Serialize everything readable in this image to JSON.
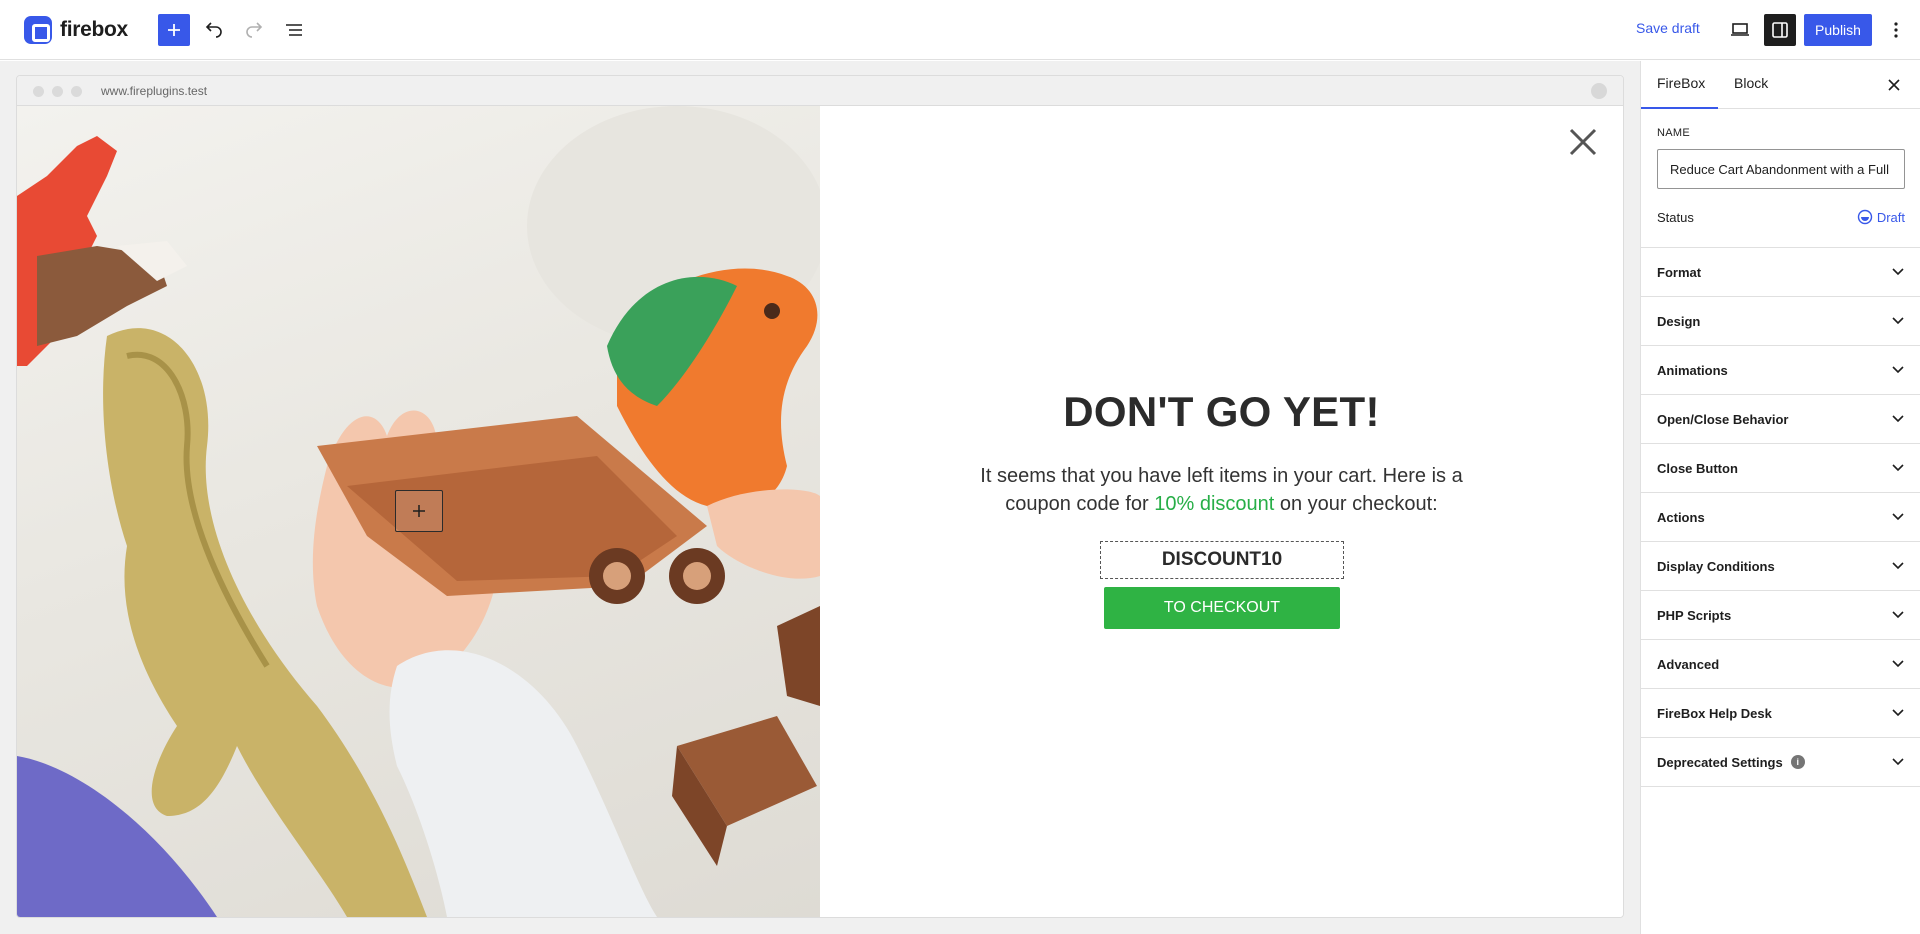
{
  "app": {
    "logo_text": "firebox"
  },
  "toolbar": {
    "save_draft_label": "Save draft",
    "publish_label": "Publish"
  },
  "browser": {
    "url": "www.fireplugins.test"
  },
  "popup": {
    "headline": "DON'T GO YET!",
    "body_before": "It seems that you have left items in your cart. Here is a coupon code for ",
    "body_highlight": "10% discount",
    "body_after": " on your checkout:",
    "coupon_code": "DISCOUNT10",
    "button_label": "TO CHECKOUT",
    "highlight_color": "#27ae47",
    "button_color": "#2fb344"
  },
  "sidebar": {
    "tabs": [
      {
        "label": "FireBox"
      },
      {
        "label": "Block"
      }
    ],
    "name_label": "NAME",
    "name_value": "Reduce Cart Abandonment with a Full",
    "status_label": "Status",
    "status_value": "Draft",
    "panels": [
      {
        "label": "Format"
      },
      {
        "label": "Design"
      },
      {
        "label": "Animations"
      },
      {
        "label": "Open/Close Behavior"
      },
      {
        "label": "Close Button"
      },
      {
        "label": "Actions"
      },
      {
        "label": "Display Conditions"
      },
      {
        "label": "PHP Scripts"
      },
      {
        "label": "Advanced"
      },
      {
        "label": "FireBox Help Desk"
      },
      {
        "label": "Deprecated Settings",
        "info": true
      }
    ]
  },
  "colors": {
    "accent": "#3858e9",
    "dark": "#1e1e1e"
  }
}
